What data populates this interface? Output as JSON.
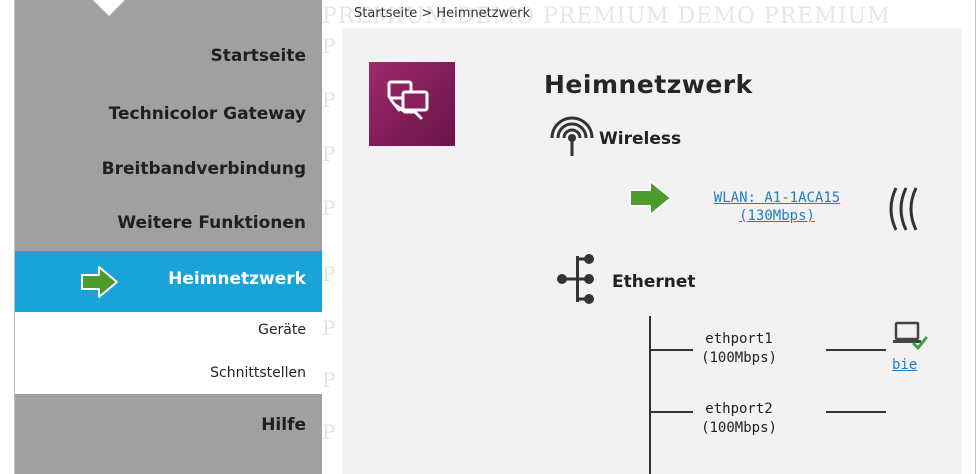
{
  "breadcrumb": "Startseite > Heimnetzwerk",
  "watermark": "PREMIUM DEMO PREMIUM DEMO PREMIUM",
  "watermark_side": "P",
  "sidebar": {
    "items": [
      {
        "label": "Startseite"
      },
      {
        "label": "Technicolor Gateway"
      },
      {
        "label": "Breitbandverbindung"
      },
      {
        "label": "Weitere Funktionen"
      }
    ],
    "active_label": "Heimnetzwerk",
    "sub_items": [
      {
        "label": "Geräte"
      },
      {
        "label": "Schnittstellen"
      }
    ],
    "help_label": "Hilfe"
  },
  "main": {
    "title": "Heimnetzwerk",
    "wireless_label": "Wireless",
    "wlan_line1": "WLAN: A1-1ACA15",
    "wlan_line2": "(130Mbps)",
    "ethernet_label": "Ethernet",
    "ports": [
      {
        "name": "ethport1",
        "speed": "(100Mbps)"
      },
      {
        "name": "ethport2",
        "speed": "(100Mbps)"
      }
    ],
    "device_link": "bie"
  },
  "colors": {
    "active": "#1aa3d6",
    "arrow_green": "#4d9a2d",
    "link": "#1a7fc4",
    "tile": "#8b1f5e"
  }
}
